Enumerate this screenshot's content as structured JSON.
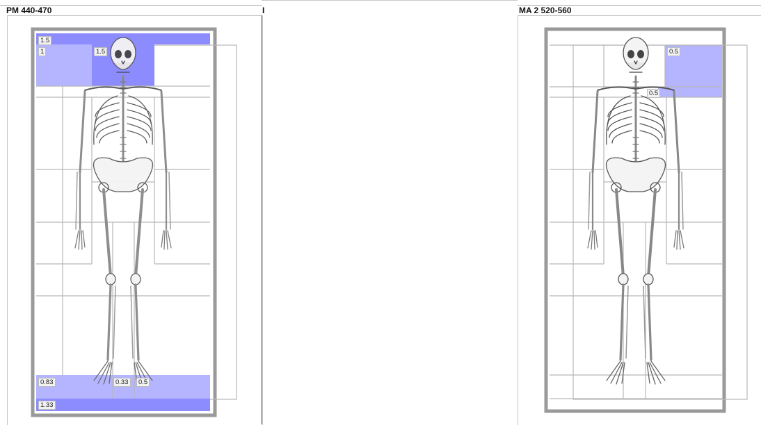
{
  "headers": {
    "left_title": "PM 440-470",
    "middle_title": "I",
    "right_title": "MA 2 520-560"
  },
  "left_panel": {
    "labels": {
      "top_band": "1.5",
      "head_left": "1",
      "head_right": "1.5",
      "foot_left": "0.83",
      "foot_mid": "0.33",
      "foot_right": "0.5",
      "bottom_band": "1.33"
    }
  },
  "right_panel": {
    "labels": {
      "head_right_upper": "0.5",
      "head_right_lower": "0.5"
    }
  },
  "colors": {
    "highlight": "#8c8cff",
    "highlight_light": "#b4b4ff",
    "frame": "#9a9a9a",
    "grid_line": "#b8b8b8"
  },
  "icons": {
    "figure": "skeleton-figure"
  }
}
